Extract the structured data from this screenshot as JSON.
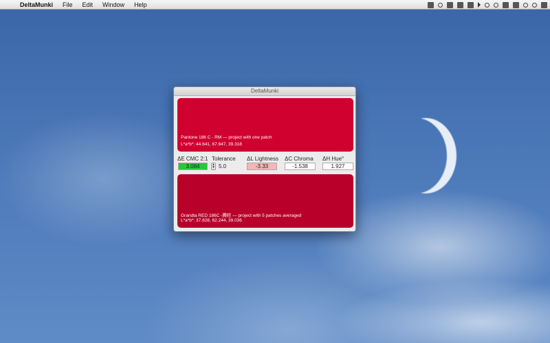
{
  "menubar": {
    "apple_icon": "apple-icon",
    "app_name": "DeltaMunki",
    "items": [
      "File",
      "Edit",
      "Window",
      "Help"
    ]
  },
  "window": {
    "title": "DeltaMunki",
    "top_patch": {
      "name": "Pantone 186 C - RM — project with one patch",
      "lab": "L*a*b*: 44.641, 67.647, 39.318",
      "color": "#d0002f"
    },
    "bottom_patch": {
      "name": "Grandta RED 186C -腾旺 — project with 5 patches averaged",
      "lab": "L*a*b*: 37.828, 62.244, 39.036",
      "color": "#b8002a"
    },
    "metrics": {
      "de_label": "ΔE CMC 2:1",
      "de_value": "3.084",
      "de_color": "#22cc33",
      "tolerance_label": "Tolerance",
      "tolerance_value": "5.0",
      "dl_label": "ΔL Lightness",
      "dl_value": "-3.33",
      "dl_color": "#f4b6b6",
      "dc_label": "ΔC Chroma",
      "dc_value": "-1.538",
      "dh_label": "ΔH Hue°",
      "dh_value": "1.927"
    }
  }
}
